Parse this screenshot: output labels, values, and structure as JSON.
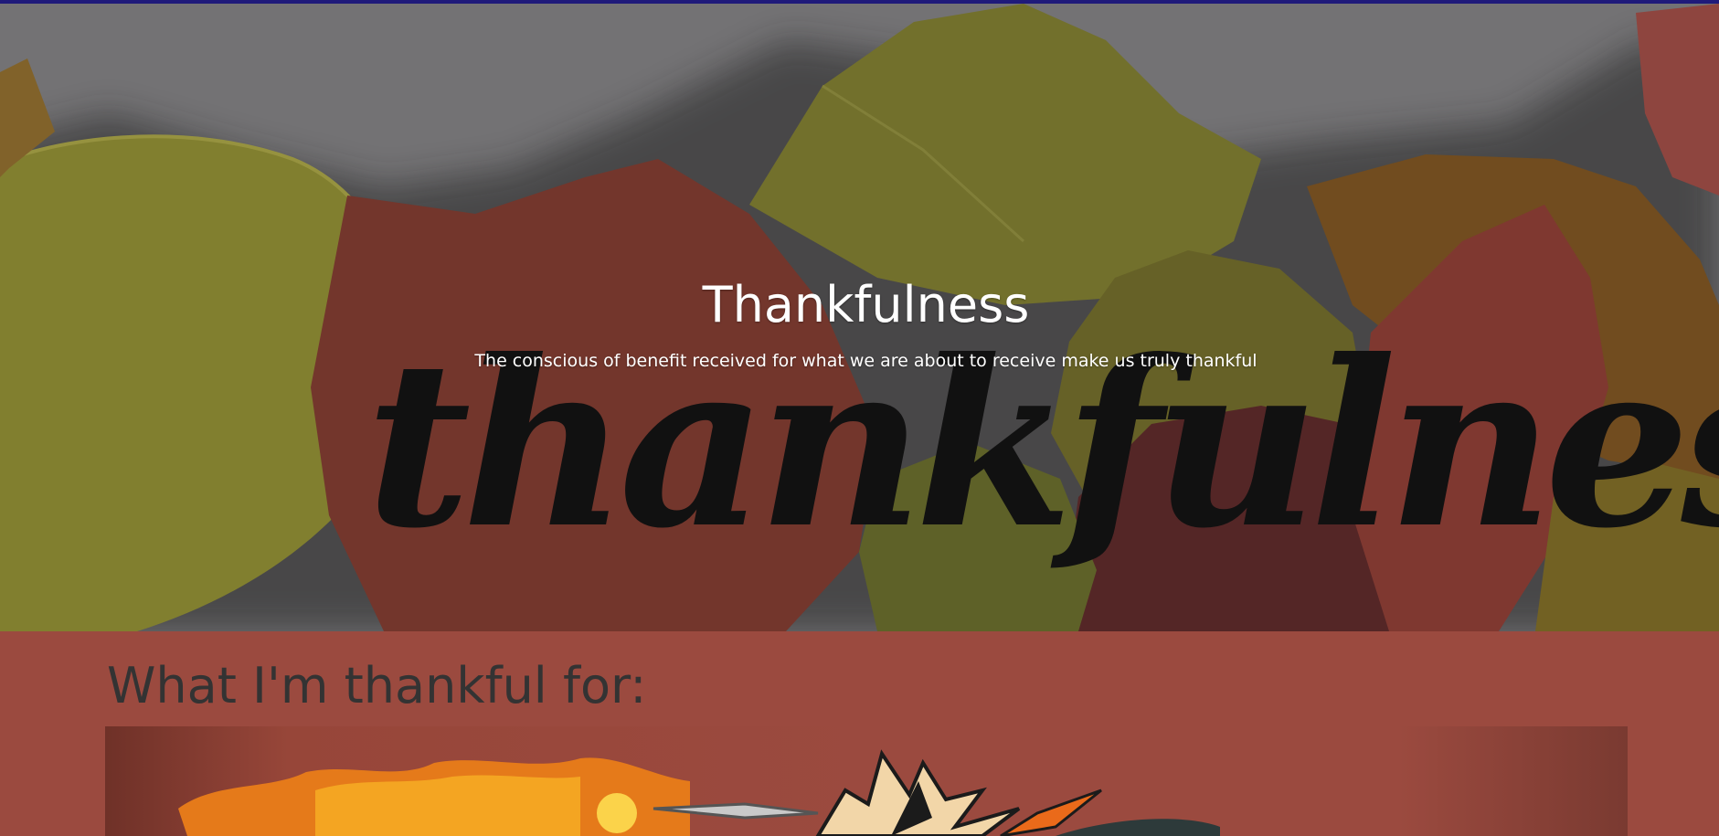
{
  "hero": {
    "title": "Thankfulness",
    "subtitle": "The conscious of benefit received for what we are about to receive make us truly thankful",
    "script_word": "thankfulness",
    "background_description_icon": "autumn-leaves-background"
  },
  "content": {
    "heading": "What I'm thankful for:",
    "image_icon": "anime-character-explosion-image"
  },
  "colors": {
    "top_strip": "#1f1a7a",
    "hero_base": "#7d7c7e",
    "section_bg": "#9b4a3f",
    "heading_text": "#333333",
    "title_text": "#ffffff"
  }
}
